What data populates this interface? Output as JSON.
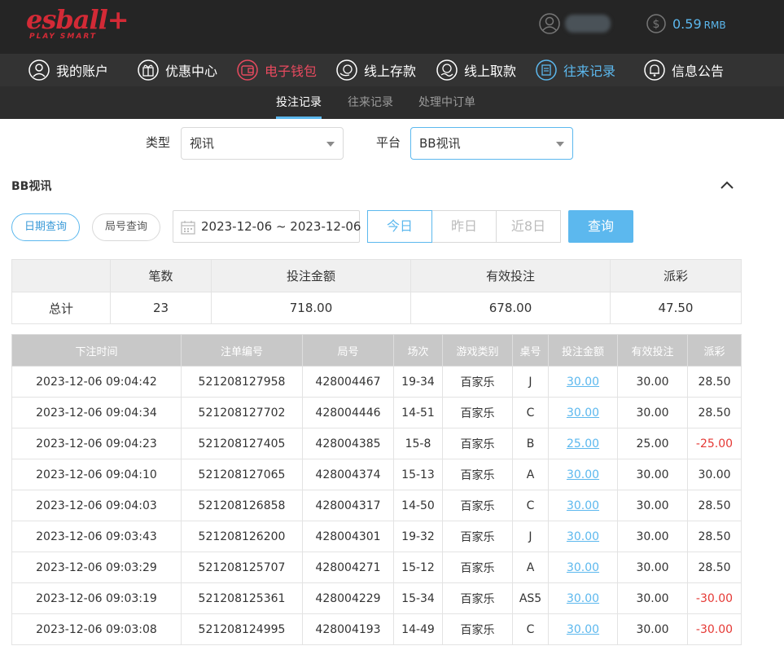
{
  "brand": {
    "logo_text": "esball+",
    "tagline": "PLAY SMART"
  },
  "account": {
    "balance": "0.59",
    "currency": "RMB"
  },
  "colors": {
    "accent": "#5cb8ee",
    "brand": "#d32a36",
    "active_nav": "#e84a5f",
    "negative": "#e53935"
  },
  "main_nav": [
    {
      "label": "我的账户",
      "icon": "user-icon"
    },
    {
      "label": "优惠中心",
      "icon": "gift-icon"
    },
    {
      "label": "电子钱包",
      "icon": "wallet-icon"
    },
    {
      "label": "线上存款",
      "icon": "deposit-icon"
    },
    {
      "label": "线上取款",
      "icon": "withdraw-icon"
    },
    {
      "label": "往来记录",
      "icon": "records-icon"
    },
    {
      "label": "信息公告",
      "icon": "bell-icon"
    }
  ],
  "sub_nav": [
    {
      "label": "投注记录"
    },
    {
      "label": "往来记录"
    },
    {
      "label": "处理中订单"
    }
  ],
  "filters": {
    "type_label": "类型",
    "type_value": "视讯",
    "platform_label": "平台",
    "platform_value": "BB视讯"
  },
  "section_title": "BB视讯",
  "query_modes": {
    "date": "日期查询",
    "round": "局号查询"
  },
  "date_range": "2023-12-06 ~ 2023-12-06",
  "quick_dates": [
    "今日",
    "昨日",
    "近8日"
  ],
  "query_button": "查询",
  "summary": {
    "headers": [
      "",
      "笔数",
      "投注金额",
      "有效投注",
      "派彩"
    ],
    "row": [
      "总计",
      "23",
      "718.00",
      "678.00",
      "47.50"
    ]
  },
  "records": {
    "headers": [
      "下注时间",
      "注单编号",
      "局号",
      "场次",
      "游戏类别",
      "桌号",
      "投注金额",
      "有效投注",
      "派彩"
    ],
    "rows": [
      [
        "2023-12-06 09:04:42",
        "521208127958",
        "428004467",
        "19-34",
        "百家乐",
        "J",
        "30.00",
        "30.00",
        "28.50"
      ],
      [
        "2023-12-06 09:04:34",
        "521208127702",
        "428004446",
        "14-51",
        "百家乐",
        "C",
        "30.00",
        "30.00",
        "28.50"
      ],
      [
        "2023-12-06 09:04:23",
        "521208127405",
        "428004385",
        "15-8",
        "百家乐",
        "B",
        "25.00",
        "25.00",
        "-25.00"
      ],
      [
        "2023-12-06 09:04:10",
        "521208127065",
        "428004374",
        "15-13",
        "百家乐",
        "A",
        "30.00",
        "30.00",
        "30.00"
      ],
      [
        "2023-12-06 09:04:03",
        "521208126858",
        "428004317",
        "14-50",
        "百家乐",
        "C",
        "30.00",
        "30.00",
        "28.50"
      ],
      [
        "2023-12-06 09:03:43",
        "521208126200",
        "428004301",
        "19-32",
        "百家乐",
        "J",
        "30.00",
        "30.00",
        "28.50"
      ],
      [
        "2023-12-06 09:03:29",
        "521208125707",
        "428004271",
        "15-12",
        "百家乐",
        "A",
        "30.00",
        "30.00",
        "28.50"
      ],
      [
        "2023-12-06 09:03:19",
        "521208125361",
        "428004229",
        "15-34",
        "百家乐",
        "AS5",
        "30.00",
        "30.00",
        "-30.00"
      ],
      [
        "2023-12-06 09:03:08",
        "521208124995",
        "428004193",
        "14-49",
        "百家乐",
        "C",
        "30.00",
        "30.00",
        "-30.00"
      ]
    ]
  }
}
